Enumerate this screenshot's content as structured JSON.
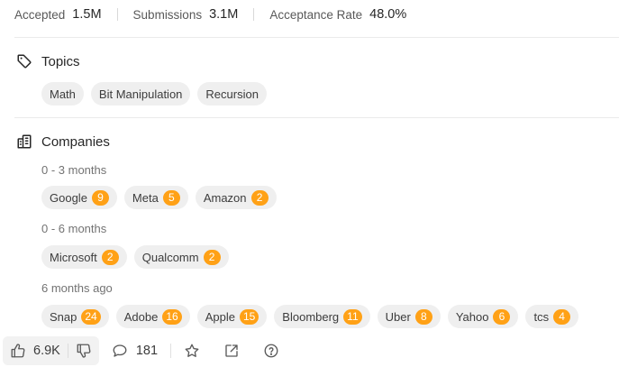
{
  "stats": {
    "accepted_label": "Accepted",
    "accepted_value": "1.5M",
    "submissions_label": "Submissions",
    "submissions_value": "3.1M",
    "rate_label": "Acceptance Rate",
    "rate_value": "48.0%"
  },
  "topics": {
    "title": "Topics",
    "icon": "tag-icon",
    "items": [
      "Math",
      "Bit Manipulation",
      "Recursion"
    ]
  },
  "companies": {
    "title": "Companies",
    "icon": "building-icon",
    "groups": [
      {
        "label": "0 - 3 months",
        "items": [
          {
            "name": "Google",
            "count": "9"
          },
          {
            "name": "Meta",
            "count": "5"
          },
          {
            "name": "Amazon",
            "count": "2"
          }
        ]
      },
      {
        "label": "0 - 6 months",
        "items": [
          {
            "name": "Microsoft",
            "count": "2"
          },
          {
            "name": "Qualcomm",
            "count": "2"
          }
        ]
      },
      {
        "label": "6 months ago",
        "items": [
          {
            "name": "Snap",
            "count": "24"
          },
          {
            "name": "Adobe",
            "count": "16"
          },
          {
            "name": "Apple",
            "count": "15"
          },
          {
            "name": "Bloomberg",
            "count": "11"
          },
          {
            "name": "Uber",
            "count": "8"
          },
          {
            "name": "Yahoo",
            "count": "6"
          },
          {
            "name": "tcs",
            "count": "4"
          }
        ]
      }
    ]
  },
  "footer": {
    "likes": "6.9K",
    "comments": "181",
    "icons": [
      "thumbs-up-icon",
      "thumbs-down-icon",
      "comment-icon",
      "star-icon",
      "share-icon",
      "help-icon"
    ]
  },
  "colors": {
    "badge": "#ffa116",
    "chip_bg": "#efefef",
    "divider": "#ebebeb"
  }
}
